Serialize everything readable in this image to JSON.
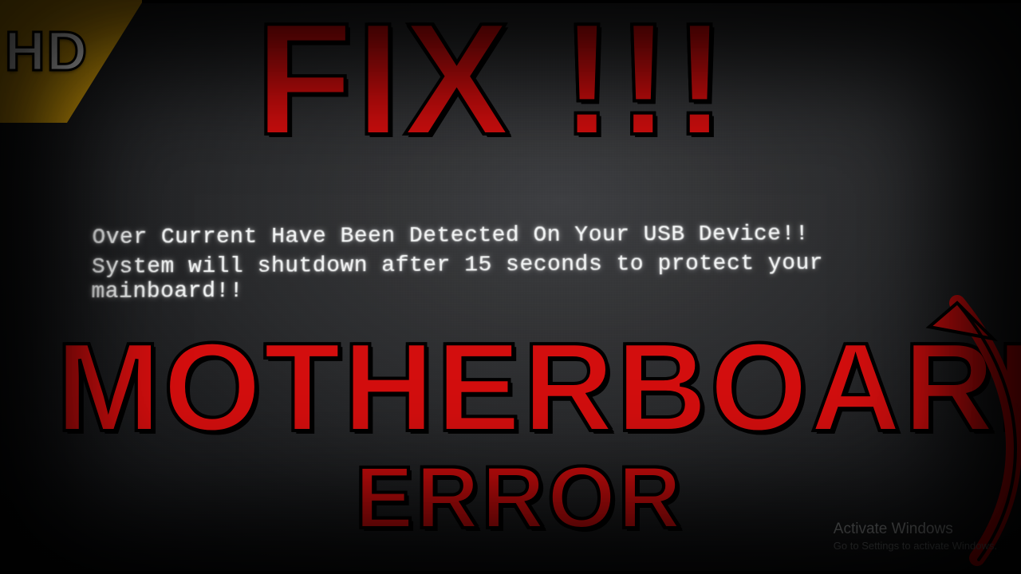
{
  "badge": {
    "hd": "HD"
  },
  "titles": {
    "fix": "FIX !!!",
    "motherboard": "MOTHERBOARD",
    "error": "ERROR"
  },
  "bios": {
    "line1": "Over Current Have Been Detected On Your USB Device!!",
    "line2": "System will shutdown after 15 seconds to protect your mainboard!!"
  },
  "watermark": {
    "title": "Activate Windows",
    "subtitle": "Go to Settings to activate Windows."
  },
  "icons": {
    "arrow": "curved-arrow-icon"
  },
  "colors": {
    "accent_red": "#d90e0e",
    "badge_yellow": "#e5a900"
  }
}
